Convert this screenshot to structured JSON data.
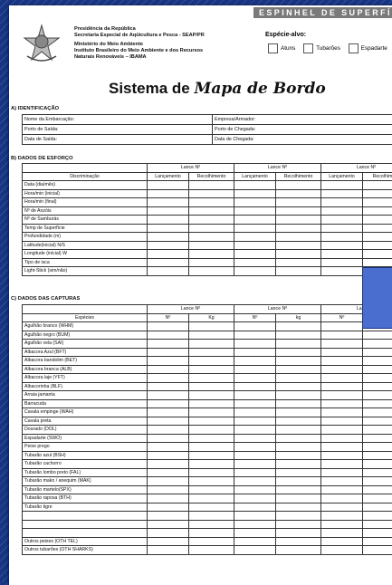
{
  "header": {
    "banner": "ESPINHEL DE SUPERFÍC",
    "org_lines": [
      "Presidência da República",
      "Secretaria Especial de Aqüicultura e Pesca - SEAP/PR",
      "Ministério do Meio Ambiente",
      "Instituto Brasileiro do Meio Ambiente e dos Recursos",
      "Naturais Renováveis – IBAMA"
    ],
    "especie_label": "Espécie-alvo:",
    "especie_options": [
      "Atuns",
      "Tubarões",
      "Espadarte"
    ]
  },
  "title": {
    "prefix": "Sistema de ",
    "script": "Mapa de Bordo"
  },
  "sections": {
    "a": "A) IDENTIFICAÇÃO",
    "b": "B) DADOS DE ESFORÇO",
    "c": "C) DADOS DAS CAPTURAS"
  },
  "identificacao": [
    [
      "Nome da Embarcação:",
      "Empresa/Armador:"
    ],
    [
      "Porto de Saída:",
      "Porto de Chegada:"
    ],
    [
      "Data de Saída:",
      "Data de Chegada:"
    ]
  ],
  "esforco": {
    "lance": "Lance Nº",
    "discriminacao": "Discriminação",
    "lancamento": "Lançamento",
    "recolhimento": "Recolhimento",
    "rows": [
      "Data (dia/mês)",
      "Hora/min (inicial)",
      "Hora/min (final)",
      "Nº de Anzóis",
      "Nº de Samburás",
      "Temp de Superfície",
      "Profundidade (m)",
      "Latitude(inicial) N/S",
      "Longitude (inicial) W",
      "Tipo de isca",
      "Light-Stick (sim/não)"
    ]
  },
  "capturas": {
    "lance": "Lance Nº",
    "especies": "Espécies",
    "n": "Nº",
    "kg": "Kg",
    "kg_lower": "kg",
    "rows": [
      "Agulhão branco (WHM)",
      "Agulhão negro (BUM)",
      "Agulhão vela (SAI)",
      "Albacora Azul (BFT)",
      "Albacora bandolim (BET)",
      "Albacora branca (ALB)",
      "Albacora laje (YFT)",
      "Albacorinha (BLF)",
      "Arraia jamanta",
      "Barracuda",
      "Cavala empinge (WAH)",
      "Cavala preta",
      "Dourado (DOL)",
      "Espadarte (SWO)",
      "Peixe prego",
      "Tubarão azul (BSH)",
      "Tubarão cachorro",
      "Tubarão lombo preto (FAL)",
      "Tubarão mako / anequim (MAK)",
      "Tubarão martelo(SPX)",
      "Tubarão raposa (BTH)",
      "Tubarão tigre",
      "",
      "",
      "",
      "Outros peixes (OTH TEL)",
      "Outros tubarões (OTH SHARKS)"
    ]
  }
}
